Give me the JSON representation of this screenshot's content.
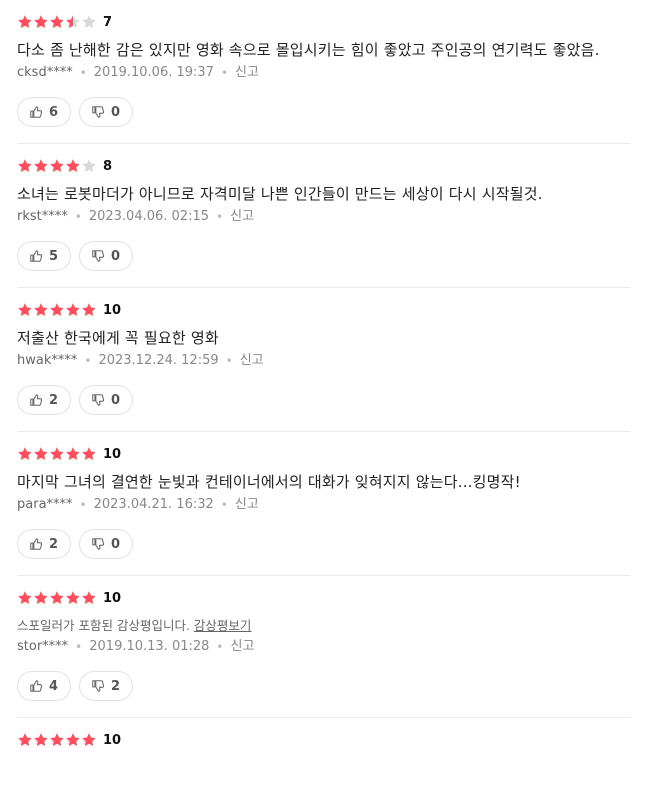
{
  "colors": {
    "star_on": "#ff4d5f",
    "star_off": "#d9d9d9"
  },
  "reviews": [
    {
      "stars": 3.5,
      "score": "7",
      "text": "다소 좀 난해한 감은 있지만 영화 속으로 몰입시키는 힘이 좋았고 주인공의 연기력도 좋았음.",
      "user": "cksd****",
      "date": "2019.10.06. 19:37",
      "report": "신고",
      "likes": "6",
      "dislikes": "0"
    },
    {
      "stars": 4,
      "score": "8",
      "text": "소녀는 로봇마더가 아니므로 자격미달 나쁜 인간들이 만드는 세상이 다시 시작될것.",
      "user": "rkst****",
      "date": "2023.04.06. 02:15",
      "report": "신고",
      "likes": "5",
      "dislikes": "0"
    },
    {
      "stars": 5,
      "score": "10",
      "text": "저출산 한국에게 꼭 필요한 영화",
      "user": "hwak****",
      "date": "2023.12.24. 12:59",
      "report": "신고",
      "likes": "2",
      "dislikes": "0"
    },
    {
      "stars": 5,
      "score": "10",
      "text": "마지막 그녀의 결연한 눈빛과 컨테이너에서의 대화가 잊혀지지 않는다...킹명작!",
      "user": "para****",
      "date": "2023.04.21. 16:32",
      "report": "신고",
      "likes": "2",
      "dislikes": "0"
    },
    {
      "stars": 5,
      "score": "10",
      "spoiler_notice": "스포일러가 포함된 감상평입니다.",
      "spoiler_link": "감상평보기",
      "user": "stor****",
      "date": "2019.10.13. 01:28",
      "report": "신고",
      "likes": "4",
      "dislikes": "2"
    },
    {
      "stars": 5,
      "score": "10"
    }
  ]
}
